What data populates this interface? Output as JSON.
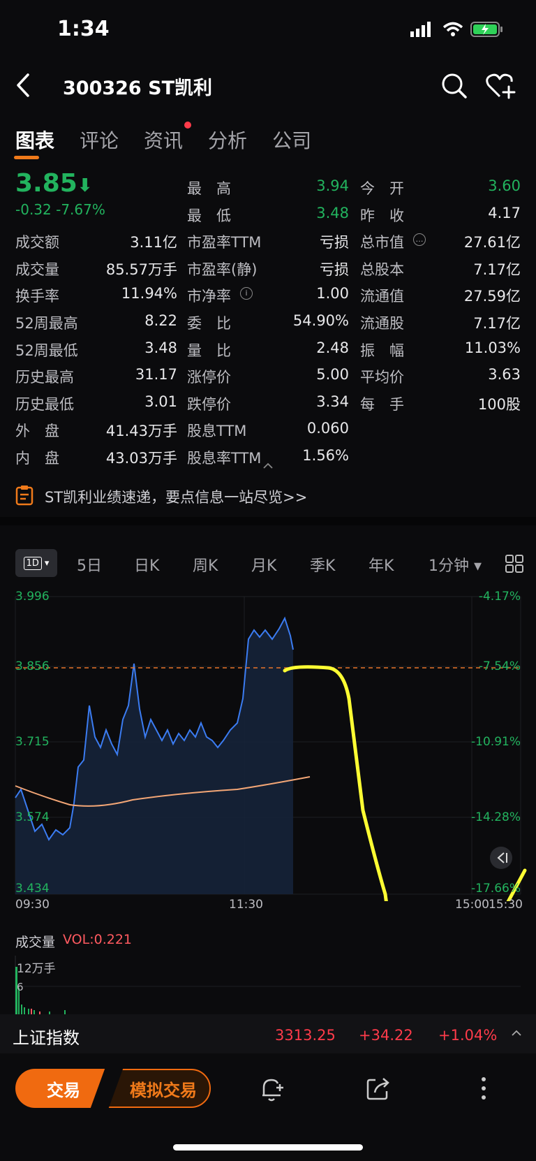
{
  "status": {
    "time": "1:34"
  },
  "header": {
    "title": "300326  ST凯利"
  },
  "tabs": [
    {
      "label": "图表",
      "active": true
    },
    {
      "label": "评论"
    },
    {
      "label": "资讯",
      "has_dot": true
    },
    {
      "label": "分析"
    },
    {
      "label": "公司"
    }
  ],
  "quote": {
    "price": "3.85",
    "change": "-0.32  -7.67%",
    "color_down": "#22b35e"
  },
  "stats": {
    "col1": [
      {
        "label": "成交额",
        "value": "3.11亿"
      },
      {
        "label": "成交量",
        "value": "85.57万手"
      },
      {
        "label": "换手率",
        "value": "11.94%"
      },
      {
        "label": "52周最高",
        "value": "8.22"
      },
      {
        "label": "52周最低",
        "value": "3.48"
      },
      {
        "label": "历史最高",
        "value": "31.17"
      },
      {
        "label": "历史最低",
        "value": "3.01"
      },
      {
        "label": "外　盘",
        "value": "41.43万手"
      },
      {
        "label": "内　盘",
        "value": "43.03万手"
      }
    ],
    "col2": [
      {
        "label": "最　高",
        "value": "3.94",
        "green": true
      },
      {
        "label": "最　低",
        "value": "3.48",
        "green": true
      },
      {
        "label": "市盈率TTM",
        "value": "亏损"
      },
      {
        "label": "市盈率(静)",
        "value": "亏损"
      },
      {
        "label": "市净率",
        "value": "1.00",
        "info": true
      },
      {
        "label": "委　比",
        "value": "54.90%"
      },
      {
        "label": "量　比",
        "value": "2.48"
      },
      {
        "label": "涨停价",
        "value": "5.00"
      },
      {
        "label": "跌停价",
        "value": "3.34"
      },
      {
        "label": "股息TTM",
        "value": "0.060"
      },
      {
        "label": "股息率TTM",
        "value": "1.56%"
      }
    ],
    "col3": [
      {
        "label": "今　开",
        "value": "3.60",
        "green": true
      },
      {
        "label": "昨　收",
        "value": "4.17"
      },
      {
        "label": "总市值",
        "value": "27.61亿",
        "more": true
      },
      {
        "label": "总股本",
        "value": "7.17亿"
      },
      {
        "label": "流通值",
        "value": "27.59亿"
      },
      {
        "label": "流通股",
        "value": "7.17亿"
      },
      {
        "label": "振　幅",
        "value": "11.03%"
      },
      {
        "label": "平均价",
        "value": "3.63"
      },
      {
        "label": "每　手",
        "value": "100股"
      }
    ]
  },
  "banner": {
    "text": "ST凯利业绩速递，要点信息一站尽览>>"
  },
  "kline_tabs": [
    "1D",
    "5日",
    "日K",
    "周K",
    "月K",
    "季K",
    "年K",
    "1分钟"
  ],
  "chart": {
    "y_left": [
      "3.996",
      "3.856",
      "3.715",
      "3.574",
      "3.434"
    ],
    "y_right": [
      "-4.17%",
      "-7.54%",
      "-10.91%",
      "-14.28%",
      "-17.66%"
    ],
    "x_labels": [
      "09:30",
      "11:30",
      "15:00",
      "15:30"
    ],
    "price_line_color": "#3b7cf2",
    "avg_line_color": "#f3a676",
    "ref_line_color": "#e8742a",
    "annotation_color": "#ffff33"
  },
  "volume": {
    "title": "成交量",
    "value": "VOL:0.221",
    "axis": [
      "12万手",
      "6"
    ]
  },
  "index_bar": {
    "name": "上证指数",
    "value": "3313.25",
    "change": "+34.22",
    "percent": "+1.04%"
  },
  "bottom": {
    "trade": "交易",
    "sim_trade": "模拟交易"
  }
}
